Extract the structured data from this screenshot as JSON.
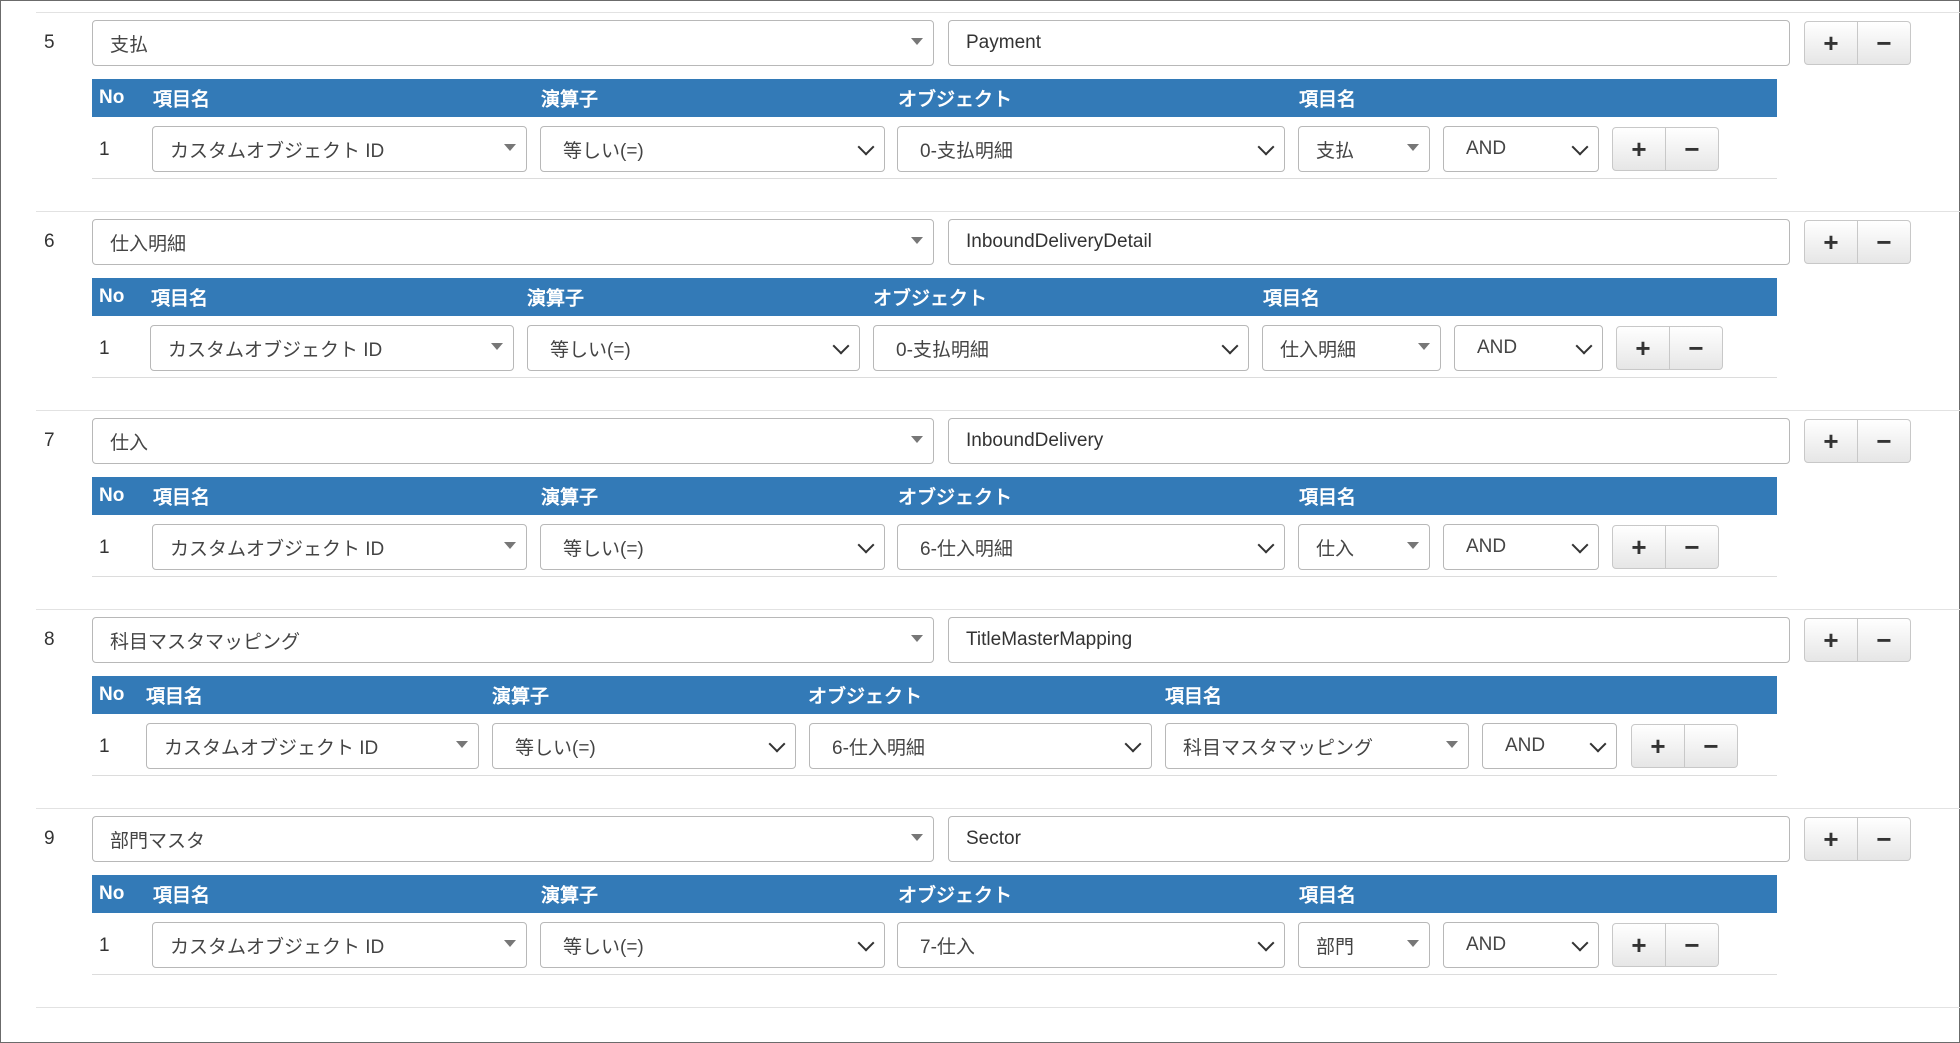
{
  "headers": {
    "no": "No",
    "field": "項目名",
    "operator": "演算子",
    "object": "オブジェクト",
    "field2": "項目名"
  },
  "buttons": {
    "plus": "+",
    "minus": "−"
  },
  "rows": [
    {
      "num": "5",
      "object": "支払",
      "api_name": "Payment",
      "condition": {
        "no": "1",
        "field": "カスタムオブジェクト ID",
        "operator": "等しい(=)",
        "object": "0-支払明細",
        "field2": "支払",
        "logic": "AND"
      }
    },
    {
      "num": "6",
      "object": "仕入明細",
      "api_name": "InboundDeliveryDetail",
      "condition": {
        "no": "1",
        "field": "カスタムオブジェクト ID",
        "operator": "等しい(=)",
        "object": "0-支払明細",
        "field2": "仕入明細",
        "logic": "AND"
      }
    },
    {
      "num": "7",
      "object": "仕入",
      "api_name": "InboundDelivery",
      "condition": {
        "no": "1",
        "field": "カスタムオブジェクト ID",
        "operator": "等しい(=)",
        "object": "6-仕入明細",
        "field2": "仕入",
        "logic": "AND"
      }
    },
    {
      "num": "8",
      "object": "科目マスタマッピング",
      "api_name": "TitleMasterMapping",
      "condition": {
        "no": "1",
        "field": "カスタムオブジェクト ID",
        "operator": "等しい(=)",
        "object": "6-仕入明細",
        "field2": "科目マスタマッピング",
        "logic": "AND"
      }
    },
    {
      "num": "9",
      "object": "部門マスタ",
      "api_name": "Sector",
      "condition": {
        "no": "1",
        "field": "カスタムオブジェクト ID",
        "operator": "等しい(=)",
        "object": "7-仕入",
        "field2": "部門",
        "logic": "AND"
      }
    }
  ]
}
